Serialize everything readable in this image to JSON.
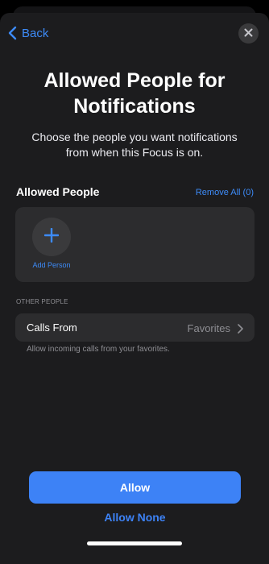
{
  "header": {
    "back_label": "Back",
    "close_icon": "close-icon",
    "back_icon": "chevron-left-icon"
  },
  "page": {
    "title_line1": "Allowed People for",
    "title_line2": "Notifications",
    "subtitle_line1": "Choose the people you want notifications",
    "subtitle_line2": "from when this Focus is on."
  },
  "allowed_people": {
    "section_title": "Allowed People",
    "remove_all_label": "Remove All (0)",
    "add_person_label": "Add Person",
    "add_icon": "plus-icon"
  },
  "other_people": {
    "section_header": "OTHER PEOPLE",
    "calls_from_label": "Calls From",
    "calls_from_value": "Favorites",
    "calls_from_footer": "Allow incoming calls from your favorites.",
    "chevron_icon": "chevron-right-icon"
  },
  "actions": {
    "allow_label": "Allow",
    "allow_none_label": "Allow None"
  },
  "colors": {
    "accent": "#3d82f6",
    "link": "#3d8bf8",
    "background": "#1c1c1e",
    "cell": "#2c2c2e",
    "secondary_text": "#8e8e93"
  }
}
